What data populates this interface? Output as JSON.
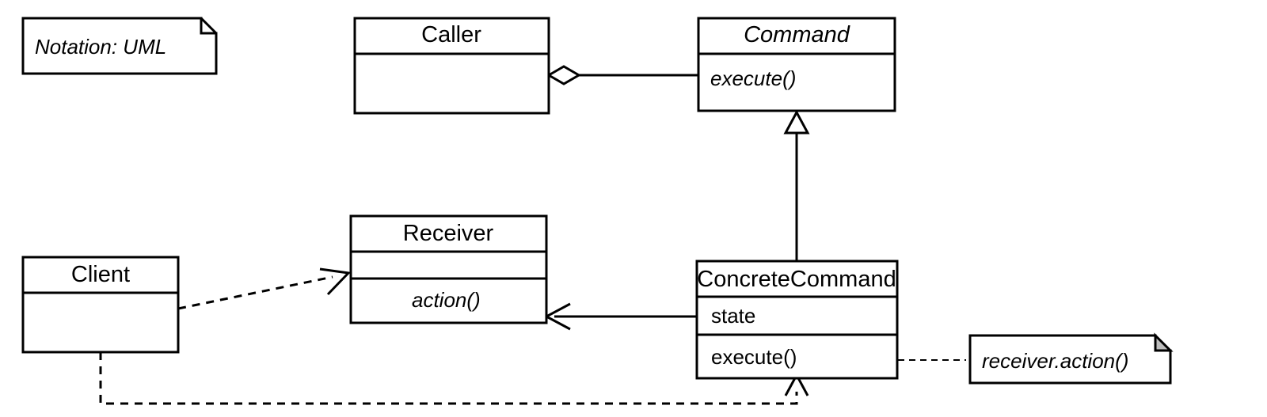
{
  "note_notation": {
    "text": "Notation: UML"
  },
  "client": {
    "name": "Client"
  },
  "caller": {
    "name": "Caller"
  },
  "command": {
    "name": "Command",
    "method": "execute()"
  },
  "receiver": {
    "name": "Receiver",
    "method": "action()"
  },
  "concrete": {
    "name": "ConcreteCommand",
    "attr": "state",
    "method": "execute()"
  },
  "note_action": {
    "text": "receiver.action()"
  },
  "chart_data": {
    "type": "table",
    "kind": "UML class diagram — Command pattern",
    "classes": [
      {
        "name": "Client",
        "abstract": false,
        "attributes": [],
        "methods": []
      },
      {
        "name": "Caller",
        "abstract": false,
        "attributes": [],
        "methods": []
      },
      {
        "name": "Receiver",
        "abstract": false,
        "attributes": [],
        "methods": [
          "action()"
        ]
      },
      {
        "name": "Command",
        "abstract": true,
        "attributes": [],
        "methods": [
          "execute()"
        ]
      },
      {
        "name": "ConcreteCommand",
        "abstract": false,
        "attributes": [
          "state"
        ],
        "methods": [
          "execute()"
        ]
      }
    ],
    "relationships": [
      {
        "from": "Client",
        "to": "Receiver",
        "type": "dependency"
      },
      {
        "from": "Client",
        "to": "ConcreteCommand",
        "type": "dependency"
      },
      {
        "from": "Caller",
        "to": "Command",
        "type": "aggregation"
      },
      {
        "from": "ConcreteCommand",
        "to": "Command",
        "type": "generalization"
      },
      {
        "from": "ConcreteCommand",
        "to": "Receiver",
        "type": "association"
      }
    ],
    "notes": [
      {
        "text": "Notation: UML"
      },
      {
        "text": "receiver.action()",
        "attachedTo": "ConcreteCommand.execute()"
      }
    ]
  }
}
